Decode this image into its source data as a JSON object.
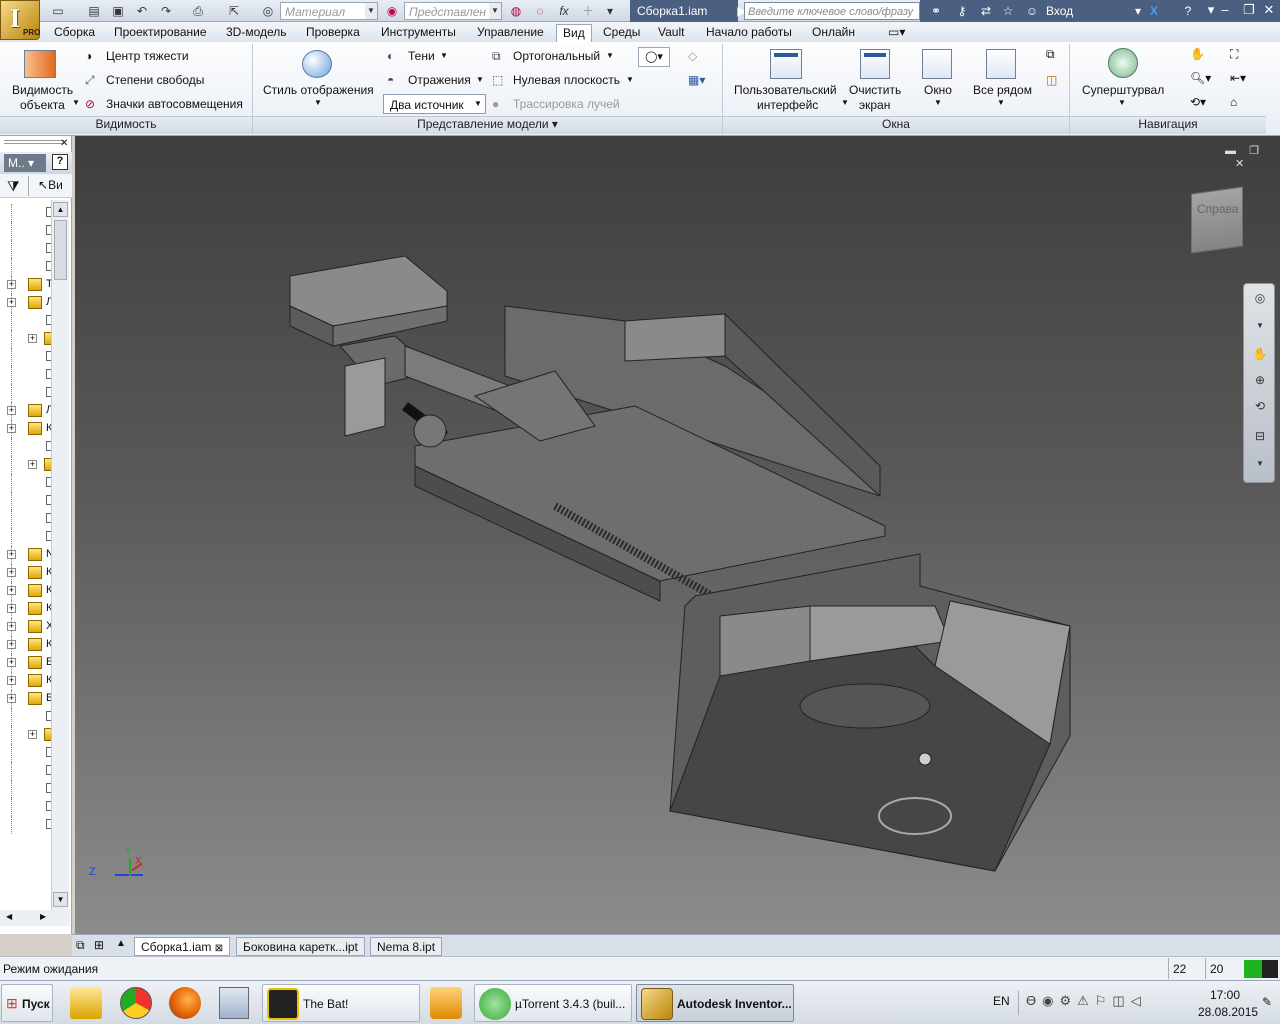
{
  "qat": {
    "material": "Материал",
    "representation": "Представлен",
    "doc_title": "Сборка1.iam",
    "search_placeholder": "Введите ключевое слово/фразу",
    "login": "Вход",
    "app_letter": "I",
    "app_badge": "PRO"
  },
  "tabs": [
    "Сборка",
    "Проектирование",
    "3D-модель",
    "Проверка",
    "Инструменты",
    "Управление",
    "Вид",
    "Среды",
    "Vault",
    "Начало работы",
    "Онлайн"
  ],
  "active_tab": "Вид",
  "ribbon": {
    "visibility": {
      "big_label_1": "Видимость",
      "big_label_2": "объекта",
      "center_gravity": "Центр тяжести",
      "dof": "Степени свободы",
      "auto_marks": "Значки автосовмещения",
      "panel": "Видимость"
    },
    "model": {
      "style_label": "Стиль отображения",
      "shadows": "Тени",
      "reflections": "Отражения",
      "light_source": "Два источник",
      "orthographic": "Ортогональный",
      "ground_plane": "Нулевая плоскость",
      "ray_tracing": "Трассировка лучей",
      "panel": "Представление модели"
    },
    "windows": {
      "user_iface_1": "Пользовательский",
      "user_iface_2": "интерфейс",
      "clean_1": "Очистить",
      "clean_2": "экран",
      "window": "Окно",
      "all_side": "Все рядом",
      "panel": "Окна"
    },
    "nav": {
      "steering": "Суперштурвал",
      "panel": "Навигация"
    }
  },
  "browser": {
    "header": "М..",
    "filter_text": "Ви",
    "rows": [
      {
        "t": "doc"
      },
      {
        "t": "doc"
      },
      {
        "t": "doc"
      },
      {
        "t": "doc"
      },
      {
        "t": "fold",
        "l": "Т"
      },
      {
        "t": "fold",
        "l": "Л"
      },
      {
        "t": "doc"
      },
      {
        "t": "fold2"
      },
      {
        "t": "doc"
      },
      {
        "t": "doc"
      },
      {
        "t": "doc"
      },
      {
        "t": "fold",
        "l": "Л"
      },
      {
        "t": "fold",
        "l": "К"
      },
      {
        "t": "doc"
      },
      {
        "t": "fold2"
      },
      {
        "t": "doc"
      },
      {
        "t": "doc"
      },
      {
        "t": "doc"
      },
      {
        "t": "doc"
      },
      {
        "t": "fold",
        "l": "N"
      },
      {
        "t": "fold",
        "l": "К"
      },
      {
        "t": "fold",
        "l": "К"
      },
      {
        "t": "fold",
        "l": "К"
      },
      {
        "t": "fold",
        "l": "Х"
      },
      {
        "t": "fold",
        "l": "К"
      },
      {
        "t": "fold",
        "l": "Б"
      },
      {
        "t": "fold",
        "l": "К"
      },
      {
        "t": "fold",
        "l": "Б"
      },
      {
        "t": "doc"
      },
      {
        "t": "fold2"
      },
      {
        "t": "doc"
      },
      {
        "t": "doc"
      },
      {
        "t": "doc"
      },
      {
        "t": "doc"
      },
      {
        "t": "doc"
      }
    ]
  },
  "viewcube": {
    "label": "Справа"
  },
  "axes": {
    "z": "Z",
    "y": "Y",
    "x": "X"
  },
  "doc_tabs": [
    "Сборка1.iam",
    "Боковина каретк...ipt",
    "Nema 8.ipt"
  ],
  "status": {
    "text": "Режим ожидания",
    "n1": "22",
    "n2": "20"
  },
  "taskbar": {
    "start": "Пуск",
    "items": [
      "The Bat!",
      "µTorrent 3.4.3  (buil...",
      "Autodesk Inventor..."
    ],
    "lang": "EN",
    "time": "17:00",
    "date": "28.08.2015"
  },
  "colors": {
    "ribbon_accent": "#1f5fa8",
    "viewport_top": "#3e3e3e",
    "viewport_bottom": "#8c8c8c",
    "status_green": "#1fb21f"
  }
}
